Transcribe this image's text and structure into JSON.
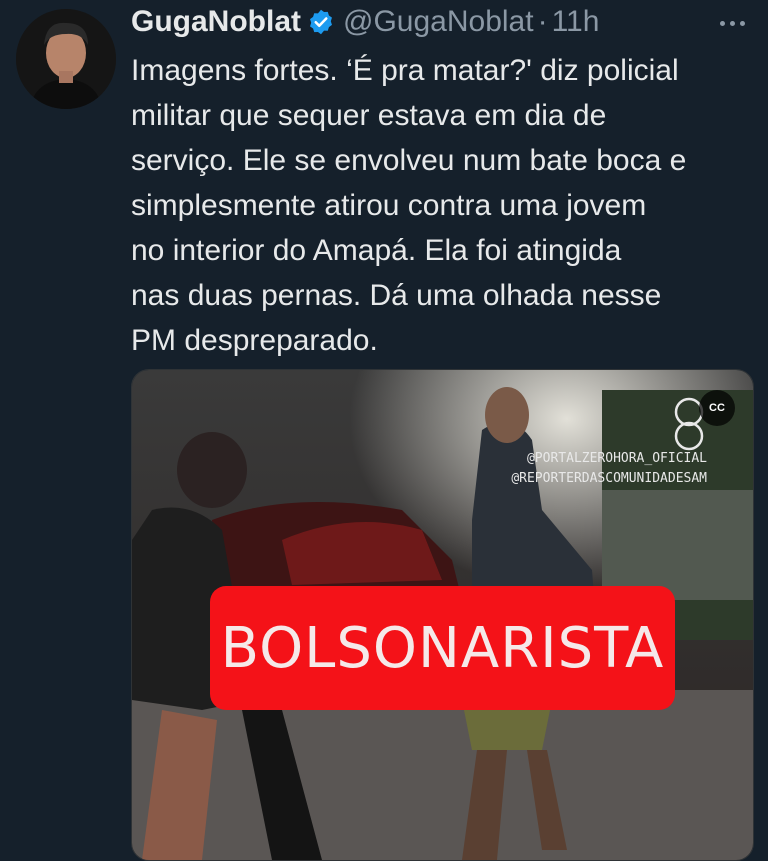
{
  "author": {
    "name": "GugaNoblat",
    "handle": "@GugaNoblat",
    "separator": "·",
    "time": "11h",
    "verified_icon": "verified-badge-icon",
    "verified_color": "#1d9bf0"
  },
  "tweet": {
    "lines": [
      "Imagens fortes. ‘É pra matar?' diz policial",
      "militar que sequer estava em dia de",
      "serviço. Ele se envolveu num bate boca e",
      "simplesmente atirou contra uma jovem",
      "no interior do Amapá. Ela foi atingida",
      "nas duas pernas. Dá uma olhada nesse",
      "PM despreparado."
    ]
  },
  "media": {
    "captions_label": "CC",
    "watermark_lines": [
      "@PORTALZEROHORA_OFICIAL",
      "@REPORTERDASCOMUNIDADESAM"
    ],
    "banner_text": "BOLSONARISTA",
    "banner_color": "#f41218"
  },
  "colors": {
    "background": "#15202b",
    "text_primary": "#e7e9ea",
    "text_secondary": "#8b98a5"
  }
}
